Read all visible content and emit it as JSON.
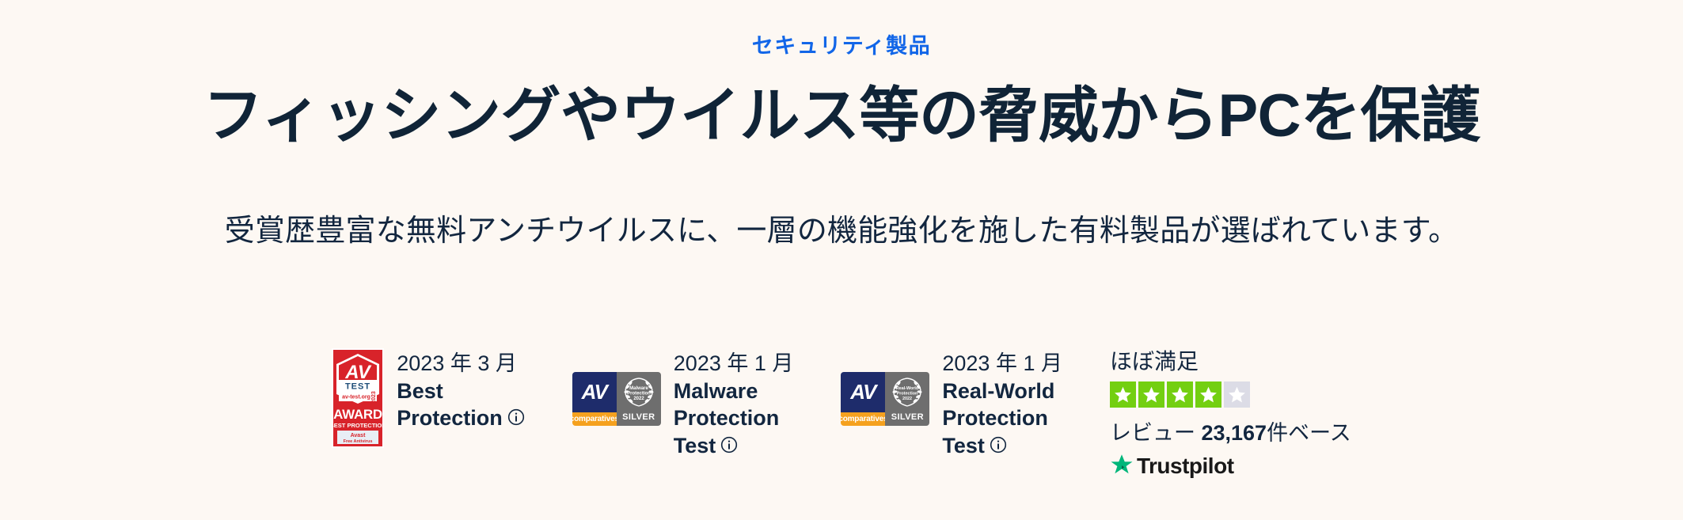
{
  "background_color": "#fdf8f3",
  "hero": {
    "eyebrow": "セキュリティ製品",
    "eyebrow_color": "#1266e8",
    "headline": "フィッシングやウイルス等の脅威からPCを保護",
    "headline_color": "#102437",
    "subheadline": "受賞歴豊富な無料アンチウイルスに、一層の機能強化を施した有料製品が選ばれています。"
  },
  "awards": [
    {
      "badge": "av-test-award-badge",
      "date": "2023 年 3 月",
      "title_line1": "Best",
      "title_line2": "Protection",
      "info_icon": "info-circle-icon",
      "badge_text": {
        "brand": "AV",
        "test": "TEST",
        "site": "av-test.org",
        "year": "2023",
        "award": "AWARD",
        "category": "BEST PROTECTION",
        "product": "Avast",
        "product_sub": "Free Antivirus"
      },
      "badge_color": "#d8232a"
    },
    {
      "badge": "av-comparatives-silver-badge",
      "date": "2023 年 1 月",
      "title_line1": "Malware",
      "title_line2": "Protection",
      "title_line3": "Test",
      "info_icon": "info-circle-icon",
      "badge_text": {
        "brand": "AV",
        "brand_sub": "comparatives",
        "medal": "SILVER",
        "wreath_line1": "Malware",
        "wreath_line2": "Protection",
        "wreath_line3": "2022"
      },
      "badge_color": "#1e2c6b",
      "badge_accent": "#f5a11e"
    },
    {
      "badge": "av-comparatives-silver-badge",
      "date": "2023 年 1 月",
      "title_line1": "Real-World",
      "title_line2": "Protection",
      "title_line3": "Test",
      "info_icon": "info-circle-icon",
      "badge_text": {
        "brand": "AV",
        "brand_sub": "comparatives",
        "medal": "SILVER",
        "wreath_line1": "Real-World",
        "wreath_line2": "Protection",
        "wreath_line3": "2022"
      },
      "badge_color": "#1e2c6b",
      "badge_accent": "#f5a11e"
    }
  ],
  "trustpilot": {
    "verdict": "ほぼ満足",
    "stars_filled": 4,
    "stars_total": 5,
    "star_on_color": "#73cf11",
    "star_off_color": "#dcdce6",
    "reviews_prefix": "レビュー ",
    "reviews_count": "23,167",
    "reviews_suffix": "件ベース",
    "logo_name": "Trustpilot",
    "logo_star_color": "#00b67a"
  }
}
